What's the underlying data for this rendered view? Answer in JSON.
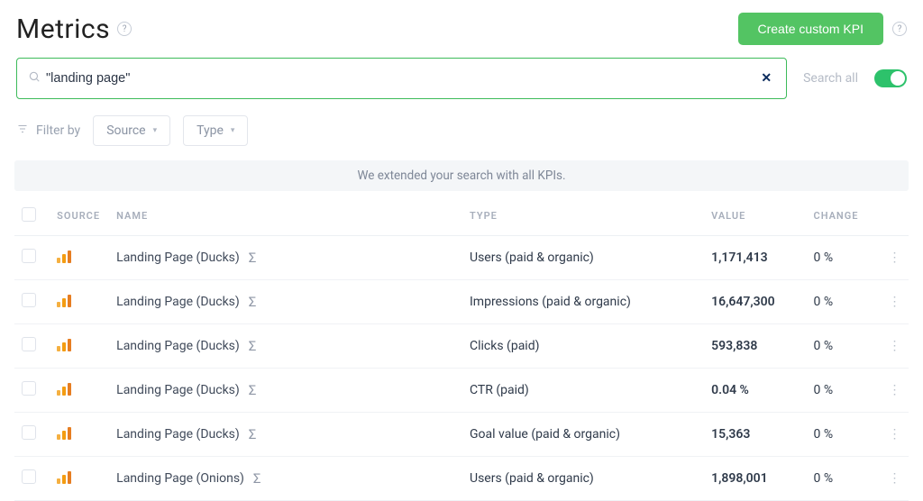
{
  "header": {
    "title": "Metrics",
    "create_button": "Create custom KPI"
  },
  "search": {
    "value": "\"landing page\"",
    "placeholder": "",
    "search_all_label": "Search all"
  },
  "filters": {
    "filter_by_label": "Filter by",
    "source_label": "Source",
    "type_label": "Type"
  },
  "banner": "We extended your search with all KPIs.",
  "table": {
    "headers": {
      "source": "SOURCE",
      "name": "NAME",
      "type": "TYPE",
      "value": "VALUE",
      "change": "CHANGE"
    },
    "rows": [
      {
        "name": "Landing Page (Ducks)",
        "type": "Users (paid & organic)",
        "value": "1,171,413",
        "change": "0 %"
      },
      {
        "name": "Landing Page (Ducks)",
        "type": "Impressions (paid & organic)",
        "value": "16,647,300",
        "change": "0 %"
      },
      {
        "name": "Landing Page (Ducks)",
        "type": "Clicks (paid)",
        "value": "593,838",
        "change": "0 %"
      },
      {
        "name": "Landing Page (Ducks)",
        "type": "CTR (paid)",
        "value": "0.04 %",
        "change": "0 %"
      },
      {
        "name": "Landing Page (Ducks)",
        "type": "Goal value (paid & organic)",
        "value": "15,363",
        "change": "0 %"
      },
      {
        "name": "Landing Page (Onions)",
        "type": "Users (paid & organic)",
        "value": "1,898,001",
        "change": "0 %"
      }
    ]
  },
  "icons": {
    "sigma": "Σ",
    "kebab": "⋮",
    "help": "?"
  }
}
